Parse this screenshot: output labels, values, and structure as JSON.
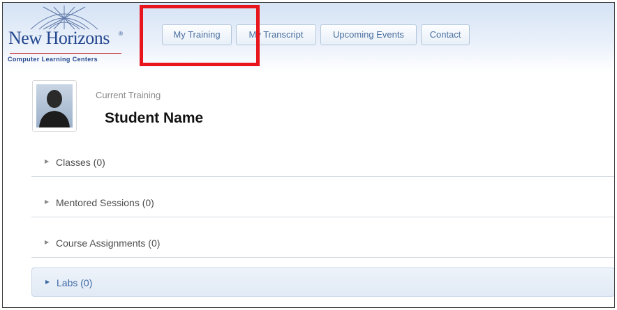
{
  "logo": {
    "name": "New Horizons",
    "trademark": "®",
    "subtitle": "Computer Learning Centers"
  },
  "nav": {
    "items": [
      {
        "label": "My Training"
      },
      {
        "label": "My Transcript"
      },
      {
        "label": "Upcoming Events"
      },
      {
        "label": "Contact"
      }
    ]
  },
  "profile": {
    "subtitle": "Current Training",
    "name": "Student Name"
  },
  "sections": [
    {
      "label": "Classes (0)"
    },
    {
      "label": "Mentored Sessions (0)"
    },
    {
      "label": "Course Assignments (0)"
    },
    {
      "label": "Labs (0)"
    }
  ],
  "colors": {
    "brand_blue": "#24478f",
    "highlight_red": "#e8151c",
    "nav_text": "#4a6f9f"
  }
}
